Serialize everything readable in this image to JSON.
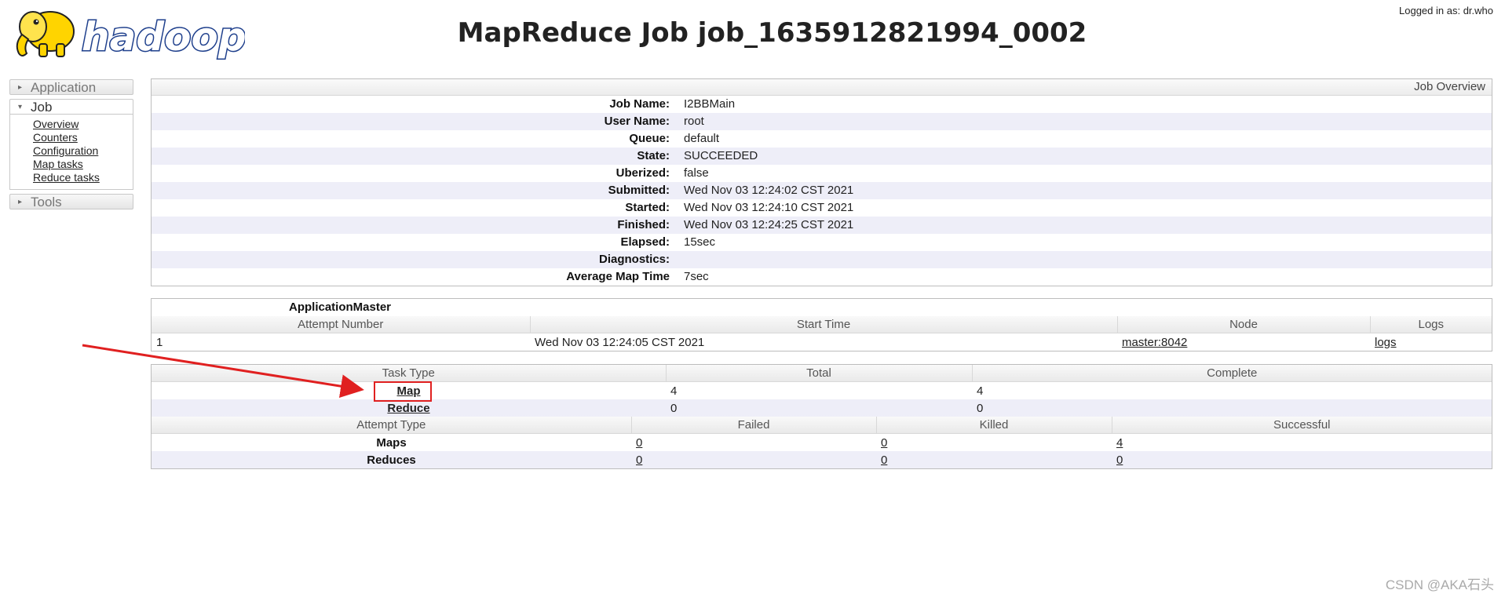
{
  "header": {
    "logo_text": "hadoop",
    "title": "MapReduce Job job_1635912821994_0002",
    "login": "Logged in as: dr.who"
  },
  "sidebar": {
    "application": "Application",
    "job": "Job",
    "job_links": [
      "Overview",
      "Counters",
      "Configuration",
      "Map tasks",
      "Reduce tasks"
    ],
    "tools": "Tools"
  },
  "overview": {
    "caption": "Job Overview",
    "rows": [
      {
        "label": "Job Name:",
        "value": "I2BBMain"
      },
      {
        "label": "User Name:",
        "value": "root"
      },
      {
        "label": "Queue:",
        "value": "default"
      },
      {
        "label": "State:",
        "value": "SUCCEEDED"
      },
      {
        "label": "Uberized:",
        "value": "false"
      },
      {
        "label": "Submitted:",
        "value": "Wed Nov 03 12:24:02 CST 2021"
      },
      {
        "label": "Started:",
        "value": "Wed Nov 03 12:24:10 CST 2021"
      },
      {
        "label": "Finished:",
        "value": "Wed Nov 03 12:24:25 CST 2021"
      },
      {
        "label": "Elapsed:",
        "value": "15sec"
      },
      {
        "label": "Diagnostics:",
        "value": ""
      },
      {
        "label": "Average Map Time",
        "value": "7sec"
      }
    ]
  },
  "app_master": {
    "title": "ApplicationMaster",
    "headers": [
      "Attempt Number",
      "Start Time",
      "Node",
      "Logs"
    ],
    "row": {
      "attempt": "1",
      "start_time": "Wed Nov 03 12:24:05 CST 2021",
      "node": "master:8042",
      "logs": "logs"
    }
  },
  "tasks": {
    "headers": [
      "Task Type",
      "Total",
      "Complete"
    ],
    "rows": [
      {
        "type": "Map",
        "total": "4",
        "complete": "4"
      },
      {
        "type": "Reduce",
        "total": "0",
        "complete": "0"
      }
    ]
  },
  "attempts": {
    "headers": [
      "Attempt Type",
      "Failed",
      "Killed",
      "Successful"
    ],
    "rows": [
      {
        "type": "Maps",
        "failed": "0",
        "killed": "0",
        "successful": "4"
      },
      {
        "type": "Reduces",
        "failed": "0",
        "killed": "0",
        "successful": "0"
      }
    ]
  },
  "watermark": "CSDN @AKA石头",
  "colors": {
    "annotation": "#e02020",
    "logo_yellow": "#ffd400",
    "logo_blue": "#1e3f8c"
  }
}
